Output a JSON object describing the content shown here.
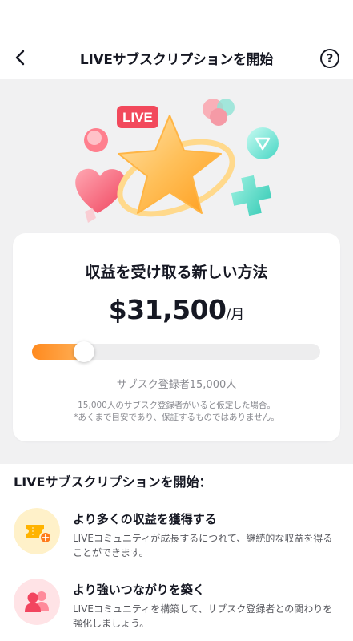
{
  "header": {
    "title": "LIVEサブスクリプションを開始",
    "back_icon": "chevron-left-icon",
    "help_icon": "question-circle-icon",
    "help_glyph": "?"
  },
  "hero": {
    "badge_label": "LIVE",
    "illustration_icons": [
      "star-icon",
      "heart-icon",
      "play-icon",
      "plus-icon",
      "ring-icon"
    ]
  },
  "earnings_card": {
    "title": "収益を受け取る新しい方法",
    "amount": "$31,500",
    "per": "/月",
    "slider_fraction": 0.18,
    "subscribers_label": "サブスク登録者15,000人",
    "note_line1": "15,000人のサブスク登録者がいると仮定した場合。",
    "note_line2": "*あくまで目安であり、保証するものではありません。"
  },
  "section": {
    "title": "LIVEサブスクリプションを開始："
  },
  "features": [
    {
      "icon": "ticket-plus-icon",
      "title": "より多くの収益を獲得する",
      "desc": "LIVEコミュニティが成長するにつれて、継続的な収益を得ることができます。"
    },
    {
      "icon": "people-icon",
      "title": "より強いつながりを築く",
      "desc": "LIVEコミュニティを構築して、サブスク登録者との関わりを強化しましょう。"
    }
  ],
  "colors": {
    "accent_orange": "#ff8a1f",
    "live_badge": "#f2495c",
    "text_primary": "#161823",
    "text_secondary": "#8a8b91",
    "hero_bg": "#f1f1f2"
  }
}
